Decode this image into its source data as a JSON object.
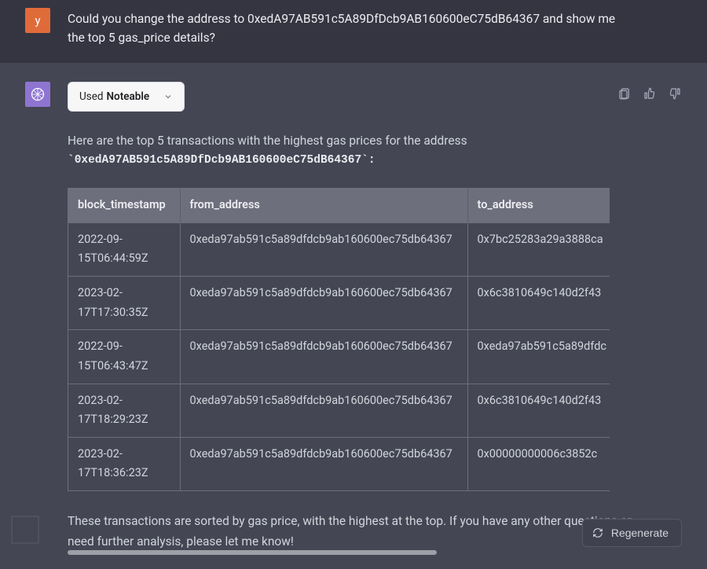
{
  "user": {
    "avatar_letter": "y",
    "message": "Could you change the address to 0xedA97AB591c5A89DfDcb9AB160600eC75dB64367 and show me the top 5 gas_price details?"
  },
  "plugin": {
    "used_prefix": "Used",
    "name": "Noteable"
  },
  "header_actions": {
    "copy": "copy",
    "thumbs_up": "thumbs-up",
    "thumbs_down": "thumbs-down"
  },
  "intro_text": "Here are the top 5 transactions with the highest gas prices for the address",
  "address_code": "`0xedA97AB591c5A89DfDcb9AB160600eC75dB64367`:",
  "table": {
    "columns": [
      "block_timestamp",
      "from_address",
      "to_address"
    ],
    "rows": [
      {
        "ts": "2022-09-15T06:44:59Z",
        "from": "0xeda97ab591c5a89dfdcb9ab160600ec75db64367",
        "to": "0x7bc25283a29a3888ca"
      },
      {
        "ts": "2023-02-17T17:30:35Z",
        "from": "0xeda97ab591c5a89dfdcb9ab160600ec75db64367",
        "to": "0x6c3810649c140d2f43"
      },
      {
        "ts": "2022-09-15T06:43:47Z",
        "from": "0xeda97ab591c5a89dfdcb9ab160600ec75db64367",
        "to": "0xeda97ab591c5a89dfdc"
      },
      {
        "ts": "2023-02-17T18:29:23Z",
        "from": "0xeda97ab591c5a89dfdcb9ab160600ec75db64367",
        "to": "0x6c3810649c140d2f43"
      },
      {
        "ts": "2023-02-17T18:36:23Z",
        "from": "0xeda97ab591c5a89dfdcb9ab160600ec75db64367",
        "to": "0x00000000006c3852c"
      }
    ]
  },
  "footer_text": "These transactions are sorted by gas price, with the highest at the top. If you have any other questions or need further analysis, please let me know!",
  "regenerate_label": "Regenerate"
}
